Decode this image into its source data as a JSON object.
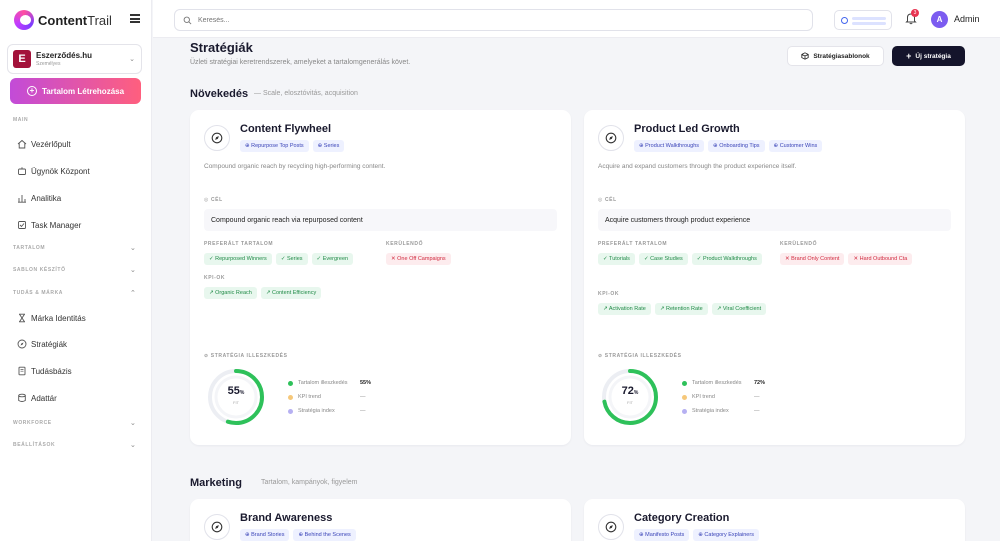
{
  "app": {
    "logo_bold": "Content",
    "logo_light": "Trail"
  },
  "workspace": {
    "name": "Eszerződés.hu",
    "sub": "Személyes",
    "initial": "E"
  },
  "create_button": "Tartalom Létrehozása",
  "sidebar": {
    "sections": [
      {
        "label": "MAIN"
      },
      {
        "label": "TARTALOM"
      },
      {
        "label": "SABLON KÉSZÍTŐ"
      },
      {
        "label": "TUDÁS & MÁRKA"
      },
      {
        "label": "WORKFORCE"
      },
      {
        "label": "BEÁLLÍTÁSOK"
      }
    ],
    "items": [
      {
        "label": "Vezérlőpult",
        "icon": "home-icon"
      },
      {
        "label": "Ügynök Központ",
        "icon": "robot-icon"
      },
      {
        "label": "Analitika",
        "icon": "bar-chart-icon"
      },
      {
        "label": "Task Manager",
        "icon": "checklist-icon"
      },
      {
        "label": "Márka Identitás",
        "icon": "hourglass-icon"
      },
      {
        "label": "Stratégiák",
        "icon": "compass-icon"
      },
      {
        "label": "Tudásbázis",
        "icon": "book-icon"
      },
      {
        "label": "Adattár",
        "icon": "database-icon"
      }
    ]
  },
  "topbar": {
    "search_placeholder": "Keresés...",
    "notification_count": "3",
    "user_initial": "A",
    "user_name": "Admin"
  },
  "page": {
    "title": "Stratégiák",
    "subtitle": "Üzleti stratégiai keretrendszerek, amelyeket a tartalomgenerálás követ.",
    "template_button": "Stratégiasablonok",
    "new_button": "Új stratégia"
  },
  "groups": [
    {
      "title": "Növekedés",
      "subtitle": "— Scale, elosztóvitás, acquisition"
    },
    {
      "title": "Marketing",
      "subtitle": "Tartalom, kampányok, figyelem"
    }
  ],
  "labels": {
    "goal": "CÉL",
    "preferred": "PREFERÁLT TARTALOM",
    "avoid": "KERÜLENDŐ",
    "kpi": "KPI-OK",
    "fit": "STRATÉGIA ILLESZKEDÉS",
    "fit_sub": "FIT",
    "pct": "%"
  },
  "cards": [
    {
      "title": "Content Flywheel",
      "tags": [
        "Repurpose Top Posts",
        "Series"
      ],
      "description": "Compound organic reach by recycling high-performing content.",
      "goal": "Compound organic reach via repurposed content",
      "preferred": [
        "Repurposed Winners",
        "Series",
        "Evergreen"
      ],
      "avoid": [
        "One Off Campaigns"
      ],
      "kpis": [
        "Organic Reach",
        "Content Efficiency"
      ],
      "fit": 55,
      "legend": [
        {
          "name": "Tartalom illeszkedés",
          "value": "55%",
          "color": "#2ec15a"
        },
        {
          "name": "KPI trend",
          "value": "—",
          "color": "#f6c87a"
        },
        {
          "name": "Stratégia index",
          "value": "—",
          "color": "#b6b0f2"
        }
      ]
    },
    {
      "title": "Product Led Growth",
      "tags": [
        "Product Walkthroughs",
        "Onboarding Tips",
        "Customer Wins"
      ],
      "description": "Acquire and expand customers through the product experience itself.",
      "goal": "Acquire customers through product experience",
      "preferred": [
        "Tutorials",
        "Case Studies",
        "Product Walkthroughs"
      ],
      "avoid": [
        "Brand Only Content",
        "Hard Outbound Cta"
      ],
      "kpis": [
        "Activation Rate",
        "Retention Rate",
        "Viral Coefficient"
      ],
      "fit": 72,
      "legend": [
        {
          "name": "Tartalom illeszkedés",
          "value": "72%",
          "color": "#2ec15a"
        },
        {
          "name": "KPI trend",
          "value": "—",
          "color": "#f6c87a"
        },
        {
          "name": "Stratégia index",
          "value": "—",
          "color": "#b6b0f2"
        }
      ]
    },
    {
      "title": "Brand Awareness",
      "tags": [
        "Brand Stories",
        "Behind the Scenes"
      ]
    },
    {
      "title": "Category Creation",
      "tags": [
        "Manifesto Posts",
        "Category Explainers"
      ]
    }
  ],
  "colors": {
    "accent": "#7b3dff",
    "fit_green": "#2ec15a",
    "dark": "#14142b"
  }
}
